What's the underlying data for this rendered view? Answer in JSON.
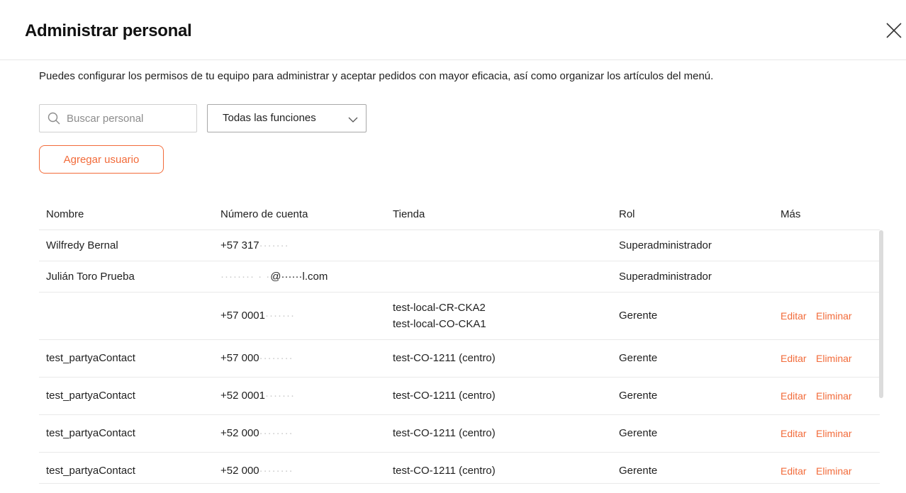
{
  "header": {
    "title": "Administrar personal",
    "close_icon": "close-icon"
  },
  "description": "Puedes configurar los permisos de tu equipo para administrar y aceptar pedidos con mayor eficacia, así como organizar los artículos del menú.",
  "search": {
    "placeholder": "Buscar personal",
    "icon": "search-icon"
  },
  "role_filter": {
    "selected": "Todas las funciones",
    "icon": "chevron-down-icon"
  },
  "add_button": {
    "label": "Agregar usuario"
  },
  "table": {
    "columns": [
      "Nombre",
      "Número de cuenta",
      "Tienda",
      "Rol",
      "Más"
    ],
    "rows": [
      {
        "name": "Wilfredy Bernal",
        "account_visible": "+57 317",
        "account_masked": "·······",
        "account_suffix": "",
        "stores": [],
        "role": "Superadministrador",
        "edit": "",
        "delete": ""
      },
      {
        "name": "Julián Toro Prueba",
        "account_visible": "",
        "account_masked": "········ · ·",
        "account_suffix": "@······l.com",
        "stores": [],
        "role": "Superadministrador",
        "edit": "",
        "delete": ""
      },
      {
        "name": "",
        "account_visible": "+57 0001",
        "account_masked": "·······",
        "account_suffix": "",
        "stores": [
          "test-local-CR-CKA2",
          "test-local-CO-CKA1"
        ],
        "role": "Gerente",
        "edit": "Editar",
        "delete": "Eliminar"
      },
      {
        "name": "test_partyaContact",
        "account_visible": "+57 000",
        "account_masked": "········",
        "account_suffix": "",
        "stores": [
          "test-CO-1211 (centro)"
        ],
        "role": "Gerente",
        "edit": "Editar",
        "delete": "Eliminar"
      },
      {
        "name": "test_partyaContact",
        "account_visible": "+52 0001",
        "account_masked": "·······",
        "account_suffix": "",
        "stores": [
          "test-CO-1211 (centro)"
        ],
        "role": "Gerente",
        "edit": "Editar",
        "delete": "Eliminar"
      },
      {
        "name": "test_partyaContact",
        "account_visible": "+52 000",
        "account_masked": "········",
        "account_suffix": "",
        "stores": [
          "test-CO-1211 (centro)"
        ],
        "role": "Gerente",
        "edit": "Editar",
        "delete": "Eliminar"
      },
      {
        "name": "test_partyaContact",
        "account_visible": "+52 000",
        "account_masked": "········",
        "account_suffix": "",
        "stores": [
          "test-CO-1211 (centro)"
        ],
        "role": "Gerente",
        "edit": "Editar",
        "delete": "Eliminar"
      }
    ]
  },
  "colors": {
    "accent": "#f26b3a",
    "border": "#e9e9e9",
    "text": "#1f1f1f"
  }
}
